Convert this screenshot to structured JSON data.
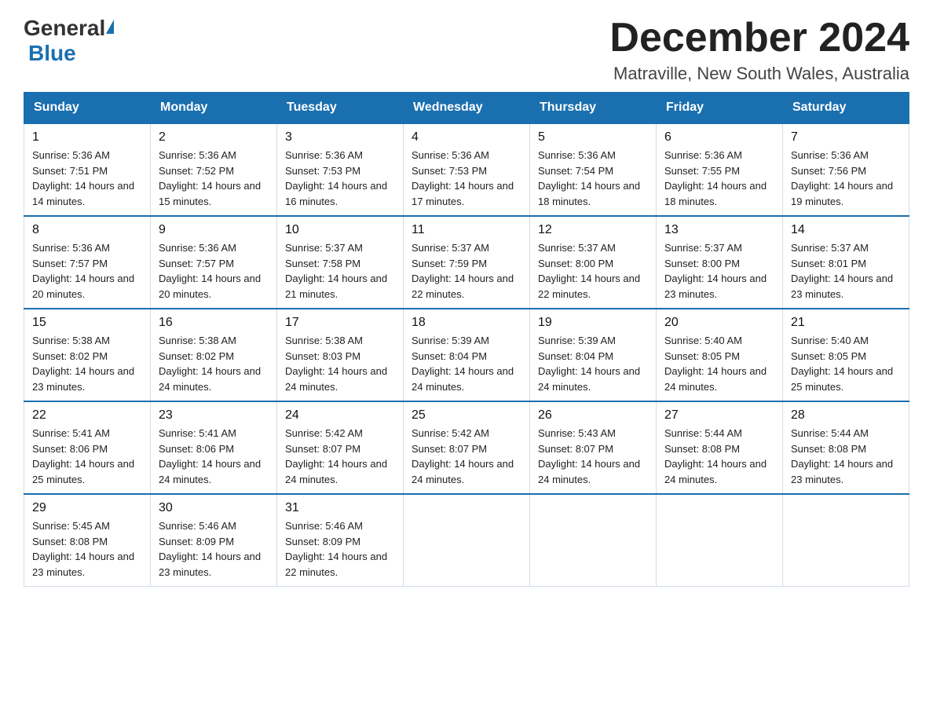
{
  "header": {
    "logo": {
      "general": "General",
      "blue": "Blue"
    },
    "month_title": "December 2024",
    "location": "Matraville, New South Wales, Australia"
  },
  "days_of_week": [
    "Sunday",
    "Monday",
    "Tuesday",
    "Wednesday",
    "Thursday",
    "Friday",
    "Saturday"
  ],
  "weeks": [
    [
      {
        "day": "1",
        "sunrise": "5:36 AM",
        "sunset": "7:51 PM",
        "daylight": "14 hours and 14 minutes."
      },
      {
        "day": "2",
        "sunrise": "5:36 AM",
        "sunset": "7:52 PM",
        "daylight": "14 hours and 15 minutes."
      },
      {
        "day": "3",
        "sunrise": "5:36 AM",
        "sunset": "7:53 PM",
        "daylight": "14 hours and 16 minutes."
      },
      {
        "day": "4",
        "sunrise": "5:36 AM",
        "sunset": "7:53 PM",
        "daylight": "14 hours and 17 minutes."
      },
      {
        "day": "5",
        "sunrise": "5:36 AM",
        "sunset": "7:54 PM",
        "daylight": "14 hours and 18 minutes."
      },
      {
        "day": "6",
        "sunrise": "5:36 AM",
        "sunset": "7:55 PM",
        "daylight": "14 hours and 18 minutes."
      },
      {
        "day": "7",
        "sunrise": "5:36 AM",
        "sunset": "7:56 PM",
        "daylight": "14 hours and 19 minutes."
      }
    ],
    [
      {
        "day": "8",
        "sunrise": "5:36 AM",
        "sunset": "7:57 PM",
        "daylight": "14 hours and 20 minutes."
      },
      {
        "day": "9",
        "sunrise": "5:36 AM",
        "sunset": "7:57 PM",
        "daylight": "14 hours and 20 minutes."
      },
      {
        "day": "10",
        "sunrise": "5:37 AM",
        "sunset": "7:58 PM",
        "daylight": "14 hours and 21 minutes."
      },
      {
        "day": "11",
        "sunrise": "5:37 AM",
        "sunset": "7:59 PM",
        "daylight": "14 hours and 22 minutes."
      },
      {
        "day": "12",
        "sunrise": "5:37 AM",
        "sunset": "8:00 PM",
        "daylight": "14 hours and 22 minutes."
      },
      {
        "day": "13",
        "sunrise": "5:37 AM",
        "sunset": "8:00 PM",
        "daylight": "14 hours and 23 minutes."
      },
      {
        "day": "14",
        "sunrise": "5:37 AM",
        "sunset": "8:01 PM",
        "daylight": "14 hours and 23 minutes."
      }
    ],
    [
      {
        "day": "15",
        "sunrise": "5:38 AM",
        "sunset": "8:02 PM",
        "daylight": "14 hours and 23 minutes."
      },
      {
        "day": "16",
        "sunrise": "5:38 AM",
        "sunset": "8:02 PM",
        "daylight": "14 hours and 24 minutes."
      },
      {
        "day": "17",
        "sunrise": "5:38 AM",
        "sunset": "8:03 PM",
        "daylight": "14 hours and 24 minutes."
      },
      {
        "day": "18",
        "sunrise": "5:39 AM",
        "sunset": "8:04 PM",
        "daylight": "14 hours and 24 minutes."
      },
      {
        "day": "19",
        "sunrise": "5:39 AM",
        "sunset": "8:04 PM",
        "daylight": "14 hours and 24 minutes."
      },
      {
        "day": "20",
        "sunrise": "5:40 AM",
        "sunset": "8:05 PM",
        "daylight": "14 hours and 24 minutes."
      },
      {
        "day": "21",
        "sunrise": "5:40 AM",
        "sunset": "8:05 PM",
        "daylight": "14 hours and 25 minutes."
      }
    ],
    [
      {
        "day": "22",
        "sunrise": "5:41 AM",
        "sunset": "8:06 PM",
        "daylight": "14 hours and 25 minutes."
      },
      {
        "day": "23",
        "sunrise": "5:41 AM",
        "sunset": "8:06 PM",
        "daylight": "14 hours and 24 minutes."
      },
      {
        "day": "24",
        "sunrise": "5:42 AM",
        "sunset": "8:07 PM",
        "daylight": "14 hours and 24 minutes."
      },
      {
        "day": "25",
        "sunrise": "5:42 AM",
        "sunset": "8:07 PM",
        "daylight": "14 hours and 24 minutes."
      },
      {
        "day": "26",
        "sunrise": "5:43 AM",
        "sunset": "8:07 PM",
        "daylight": "14 hours and 24 minutes."
      },
      {
        "day": "27",
        "sunrise": "5:44 AM",
        "sunset": "8:08 PM",
        "daylight": "14 hours and 24 minutes."
      },
      {
        "day": "28",
        "sunrise": "5:44 AM",
        "sunset": "8:08 PM",
        "daylight": "14 hours and 23 minutes."
      }
    ],
    [
      {
        "day": "29",
        "sunrise": "5:45 AM",
        "sunset": "8:08 PM",
        "daylight": "14 hours and 23 minutes."
      },
      {
        "day": "30",
        "sunrise": "5:46 AM",
        "sunset": "8:09 PM",
        "daylight": "14 hours and 23 minutes."
      },
      {
        "day": "31",
        "sunrise": "5:46 AM",
        "sunset": "8:09 PM",
        "daylight": "14 hours and 22 minutes."
      },
      null,
      null,
      null,
      null
    ]
  ]
}
